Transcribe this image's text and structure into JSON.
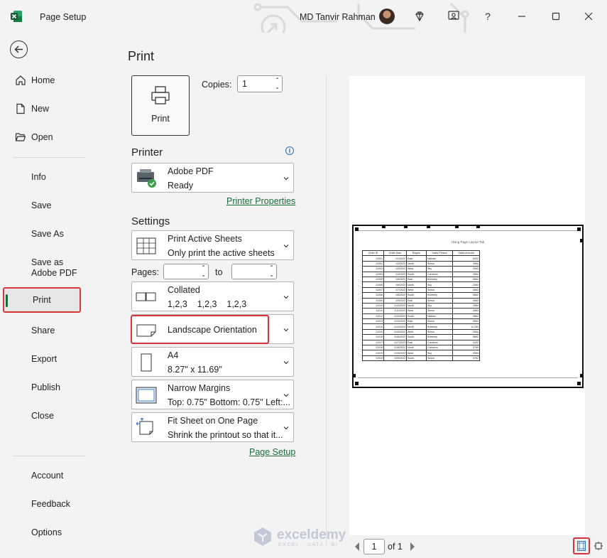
{
  "window": {
    "title": "Page Setup",
    "user_name": "MD Tanvir Rahman"
  },
  "nav": {
    "items_top": [
      {
        "label": "Home",
        "icon": "home-icon"
      },
      {
        "label": "New",
        "icon": "new-file-icon"
      },
      {
        "label": "Open",
        "icon": "folder-open-icon"
      }
    ],
    "items_mid": [
      "Info",
      "Save",
      "Save As",
      "Save as Adobe PDF",
      "Print",
      "Share",
      "Export",
      "Publish",
      "Close"
    ],
    "items_bottom": [
      "Account",
      "Feedback",
      "Options"
    ],
    "selected": "Print"
  },
  "main": {
    "title": "Print",
    "print_button_label": "Print",
    "copies_label": "Copies:",
    "copies_value": "1",
    "printer_heading": "Printer",
    "printer_name": "Adobe PDF",
    "printer_status": "Ready",
    "printer_properties_link": "Printer Properties",
    "settings_heading": "Settings",
    "settings": {
      "sheets_main": "Print Active Sheets",
      "sheets_sub": "Only print the active sheets",
      "pages_label": "Pages:",
      "pages_to": "to",
      "collate_main": "Collated",
      "collate_sub": "1,2,3    1,2,3    1,2,3",
      "orientation": "Landscape Orientation",
      "paper_main": "A4",
      "paper_sub": "8.27\" x 11.69\"",
      "margins_main": "Narrow Margins",
      "margins_sub": "Top: 0.75\" Bottom: 0.75\" Left:...",
      "scaling_main": "Fit Sheet on One Page",
      "scaling_sub": "Shrink the printout so that it..."
    },
    "page_setup_link": "Page Setup"
  },
  "preview": {
    "sheet_title": "Using Page Layout Tab",
    "columns": [
      "Order ID",
      "Order Date",
      "Region",
      "Sales Person",
      "Sales Amount"
    ],
    "rows": [
      [
        "11001",
        "1/1/2022",
        "East",
        "Nathan",
        "5432"
      ],
      [
        "11002",
        "1/2/2022",
        "North",
        "Simon",
        "3964"
      ],
      [
        "11003",
        "1/3/2022",
        "West",
        "Sky",
        "2563"
      ],
      [
        "11004",
        "1/4/2022",
        "South",
        "Cameron",
        "3564"
      ],
      [
        "11005",
        "1/5/2022",
        "East",
        "Kimberly",
        "5864"
      ],
      [
        "11006",
        "1/6/2022",
        "North",
        "Sky",
        "2563"
      ],
      [
        "11007",
        "1/7/2022",
        "West",
        "Simon",
        "4563"
      ],
      [
        "11008",
        "1/8/2022",
        "South",
        "Kimberly",
        "5862"
      ],
      [
        "11009",
        "1/9/2022",
        "East",
        "Simon",
        "4563"
      ],
      [
        "11010",
        "1/10/2022",
        "North",
        "Sky",
        "3564"
      ],
      [
        "11011",
        "1/11/2022",
        "West",
        "Simon",
        "4563"
      ],
      [
        "11012",
        "1/12/2022",
        "South",
        "Nathan",
        "3862"
      ],
      [
        "11013",
        "1/13/2022",
        "East",
        "Simon",
        "5963"
      ],
      [
        "11014",
        "1/14/2022",
        "North",
        "Kimberly",
        "11,253"
      ],
      [
        "11015",
        "1/15/2022",
        "West",
        "Simon",
        "3564"
      ],
      [
        "11016",
        "1/16/2022",
        "South",
        "Kimberly",
        "5862"
      ],
      [
        "11017",
        "1/17/2022",
        "East",
        "Cameron",
        "3432"
      ],
      [
        "11018",
        "1/18/2022",
        "North",
        "Cameron",
        "3760"
      ],
      [
        "11019",
        "1/19/2022",
        "West",
        "Sky",
        "3564"
      ],
      [
        "11020",
        "1/20/2022",
        "South",
        "Simon",
        "4762"
      ]
    ],
    "page_current": "1",
    "page_of": "of 1"
  },
  "watermark": {
    "name": "exceldemy",
    "tagline": "EXCEL · DATA · BI"
  },
  "colors": {
    "accent_green": "#1b6b39",
    "highlight_red": "#d9343b",
    "info_blue": "#2a6ebb"
  }
}
